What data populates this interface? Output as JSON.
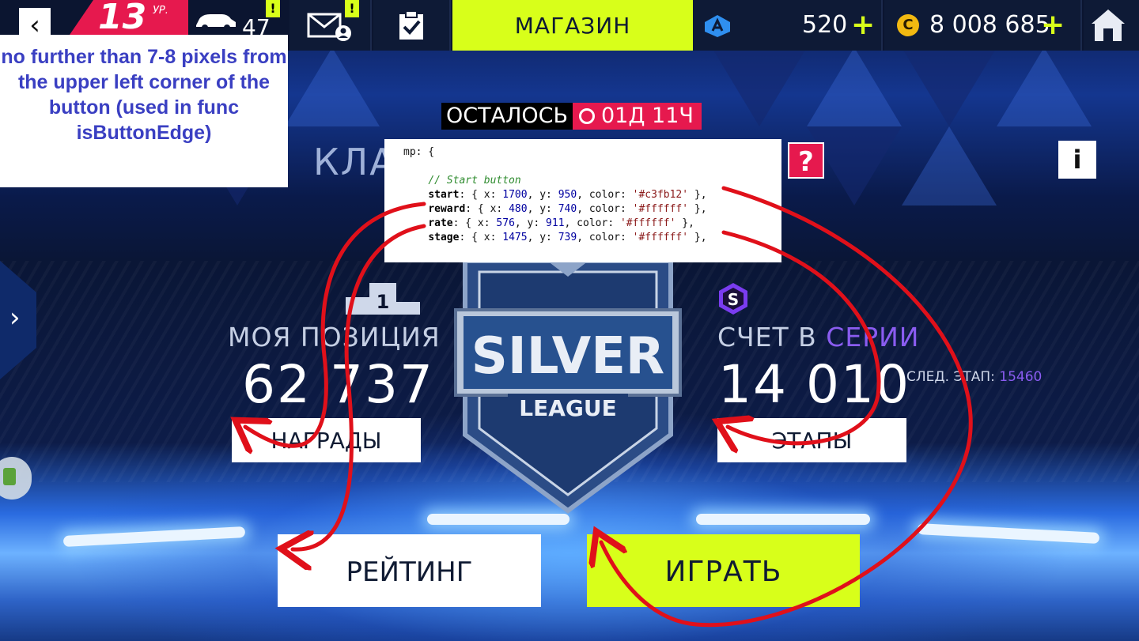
{
  "topbar": {
    "back_icon": "‹",
    "level": "13",
    "level_suffix": "УР.",
    "cars_count": "47",
    "alert_mark": "!",
    "shop_label": "МАГАЗИН",
    "tokens": "520",
    "plus": "+",
    "coin_symbol": "C",
    "credits": "8 008 685"
  },
  "note": {
    "text": "no further than 7-8 pixels from the upper left corner of the button (used in func isButtonEdge)"
  },
  "timer": {
    "label": "ОСТАЛОСЬ",
    "time": "01Д 11Ч"
  },
  "title_partial": "КЛА",
  "help_label": "?",
  "info_label": "i",
  "code": {
    "line1": "mp: {",
    "comment": "// Start button",
    "start": {
      "key": "start",
      "x": "1700",
      "y": "950",
      "color": "'#c3fb12'"
    },
    "reward": {
      "key": "reward",
      "x": "480",
      "y": "740",
      "color": "'#ffffff'"
    },
    "rate": {
      "key": "rate",
      "x": "576",
      "y": "911",
      "color": "'#ffffff'"
    },
    "stage": {
      "key": "stage",
      "x": "1475",
      "y": "739",
      "color": "'#ffffff'"
    }
  },
  "side_arrow": "›",
  "position": {
    "podium_number": "1",
    "label": "МОЯ ПОЗИЦИЯ",
    "value": "62 737",
    "button": "НАГРАДЫ"
  },
  "emblem": {
    "word": "SILVER",
    "sub": "LEAGUE"
  },
  "series": {
    "label_a": "СЧЕТ В ",
    "label_b": "СЕРИИ",
    "value": "14 010",
    "next_label": "СЛЕД. ЭТАП: ",
    "next_value": "15460",
    "button": "ЭТАПЫ"
  },
  "rating_button": "РЕЙТИНГ",
  "play_button": "ИГРАТЬ",
  "colors": {
    "accent_lime": "#d8ff1a",
    "accent_pink": "#e6194e",
    "arrow_red": "#e0101a",
    "note_blue": "#3a3fc2",
    "series_purple": "#8a5cf0"
  }
}
